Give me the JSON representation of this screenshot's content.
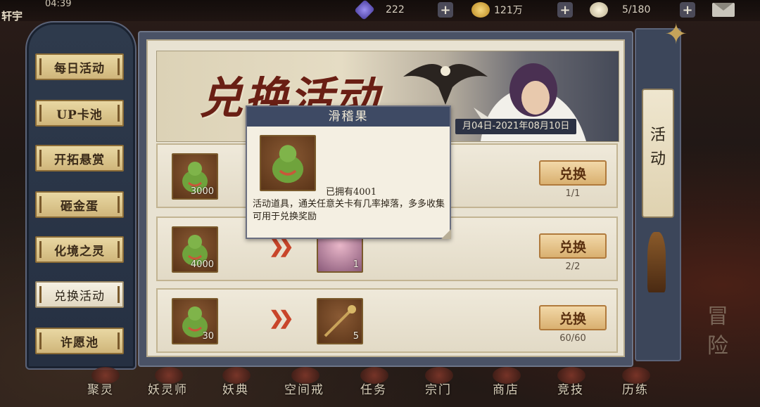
{
  "status_bar": {
    "player_name": "轩宇",
    "clock": "04:39",
    "resources": [
      {
        "icon": "gem-icon",
        "value": "222",
        "color": "#7b6fd6"
      },
      {
        "icon": "gold-coin-icon",
        "value": "121万",
        "color": "#e0b43c"
      },
      {
        "icon": "stamina-bowl-icon",
        "value": "5/180",
        "color": "#e8e0c8"
      }
    ],
    "plus_label": "+"
  },
  "left_nav": {
    "items": [
      {
        "label": "每日活动",
        "active": false
      },
      {
        "label": "UP卡池",
        "active": false
      },
      {
        "label": "开拓悬赏",
        "active": false
      },
      {
        "label": "砸金蛋",
        "active": false
      },
      {
        "label": "化境之灵",
        "active": false
      },
      {
        "label": "兑换活动",
        "active": true
      },
      {
        "label": "许愿池",
        "active": false
      }
    ]
  },
  "banner": {
    "title": "兑换活动",
    "date_range": "月04日-2021年08月10日"
  },
  "exchange_rows": [
    {
      "cost_icon": "huajiguo-icon",
      "cost_count": "3000",
      "button": "兑换",
      "limit": "1/1"
    },
    {
      "cost_icon": "huajiguo-icon",
      "cost_count": "4000",
      "reward_icon": "character-portrait-icon",
      "reward_count": "1",
      "button": "兑换",
      "limit": "2/2"
    },
    {
      "cost_icon": "huajiguo-icon",
      "cost_count": "30",
      "reward_icon": "staff-icon",
      "reward_count": "5",
      "button": "兑换",
      "limit": "60/60"
    }
  ],
  "tooltip": {
    "title": "滑稽果",
    "owned": "已拥有4001",
    "description": "活动道具，通关任意关卡有几率掉落，多多收集可用于兑换奖励"
  },
  "right_panel": {
    "scroll_label_1": "活",
    "scroll_label_2": "动",
    "adventure_1": "冒",
    "adventure_2": "险"
  },
  "bottom_nav": {
    "items": [
      "聚灵",
      "妖灵师",
      "妖典",
      "空间戒",
      "任务",
      "宗门",
      "商店",
      "竞技",
      "历练"
    ]
  }
}
